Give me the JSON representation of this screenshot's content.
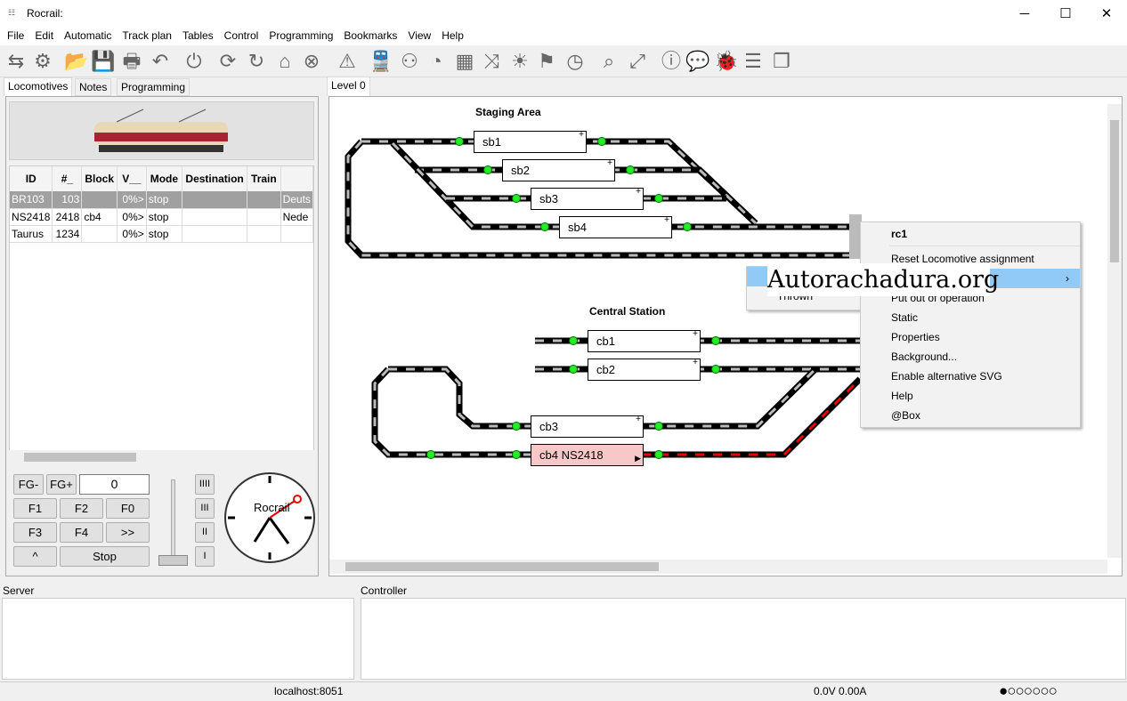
{
  "window": {
    "title": "Rocrail:",
    "minimize": "─",
    "maximize": "☐",
    "close": "✕"
  },
  "menu": [
    "File",
    "Edit",
    "Automatic",
    "Track plan",
    "Tables",
    "Control",
    "Programming",
    "Bookmarks",
    "View",
    "Help"
  ],
  "toolbar_icons": [
    "connect-icon",
    "settings-icon",
    "open-icon",
    "save-icon",
    "print-icon",
    "undo-icon",
    "power-icon",
    "sync-icon",
    "rotate-icon",
    "home-icon",
    "cancel-icon",
    "warning-icon",
    "train-icon",
    "loco-icon",
    "speedometer-icon",
    "grid-icon",
    "shuffle-icon",
    "light-icon",
    "flag-icon",
    "clock-icon",
    "zoom-icon",
    "fullscreen-icon",
    "info-icon",
    "chat-icon",
    "bug-icon",
    "list-icon",
    "document-icon"
  ],
  "left_tabs": [
    "Locomotives",
    "Notes",
    "Programming"
  ],
  "loco_table": {
    "headers": [
      "ID",
      "#_",
      "Block",
      "V__",
      "Mode",
      "Destination",
      "Train",
      ""
    ],
    "rows": [
      [
        "BR103",
        "103",
        "",
        "0%>",
        "stop",
        "",
        "",
        "Deuts"
      ],
      [
        "NS2418",
        "2418",
        "cb4",
        "0%>",
        "stop",
        "",
        "",
        "Nede"
      ],
      [
        "Taurus",
        "1234",
        "",
        "0%>",
        "stop",
        "",
        "",
        ""
      ]
    ]
  },
  "controls": {
    "fg_minus": "FG-",
    "fg_plus": "FG+",
    "speed": "0",
    "f1": "F1",
    "f2": "F2",
    "f0": "F0",
    "f3": "F3",
    "f4": "F4",
    "more": ">>",
    "up": "^",
    "stop": "Stop",
    "gear4": "IIII",
    "gear3": "III",
    "gear2": "II",
    "gear1": "I",
    "clock_label": "Rocrail"
  },
  "level_tab": "Level 0",
  "trackplan": {
    "staging_title": "Staging Area",
    "central_title": "Central Station",
    "blocks": [
      "sb1",
      "sb2",
      "sb3",
      "sb4",
      "cb1",
      "cb2",
      "cb3",
      "cb4 NS2418"
    ],
    "occupied_color": "#f8c8c8"
  },
  "context_menu": {
    "title": "rc1",
    "items": [
      "Reset Locomotive assignment",
      "",
      "Put out of operation",
      "Static",
      "Properties",
      "Background...",
      "Enable alternative SVG",
      "Help",
      "@Box"
    ]
  },
  "submenu": {
    "items": [
      "",
      "Thrown"
    ]
  },
  "watermark": "Autorachadura.org",
  "bottom": {
    "server_label": "Server",
    "controller_label": "Controller"
  },
  "status": {
    "host": "localhost:8051",
    "power": "0.0V 0.00A"
  }
}
